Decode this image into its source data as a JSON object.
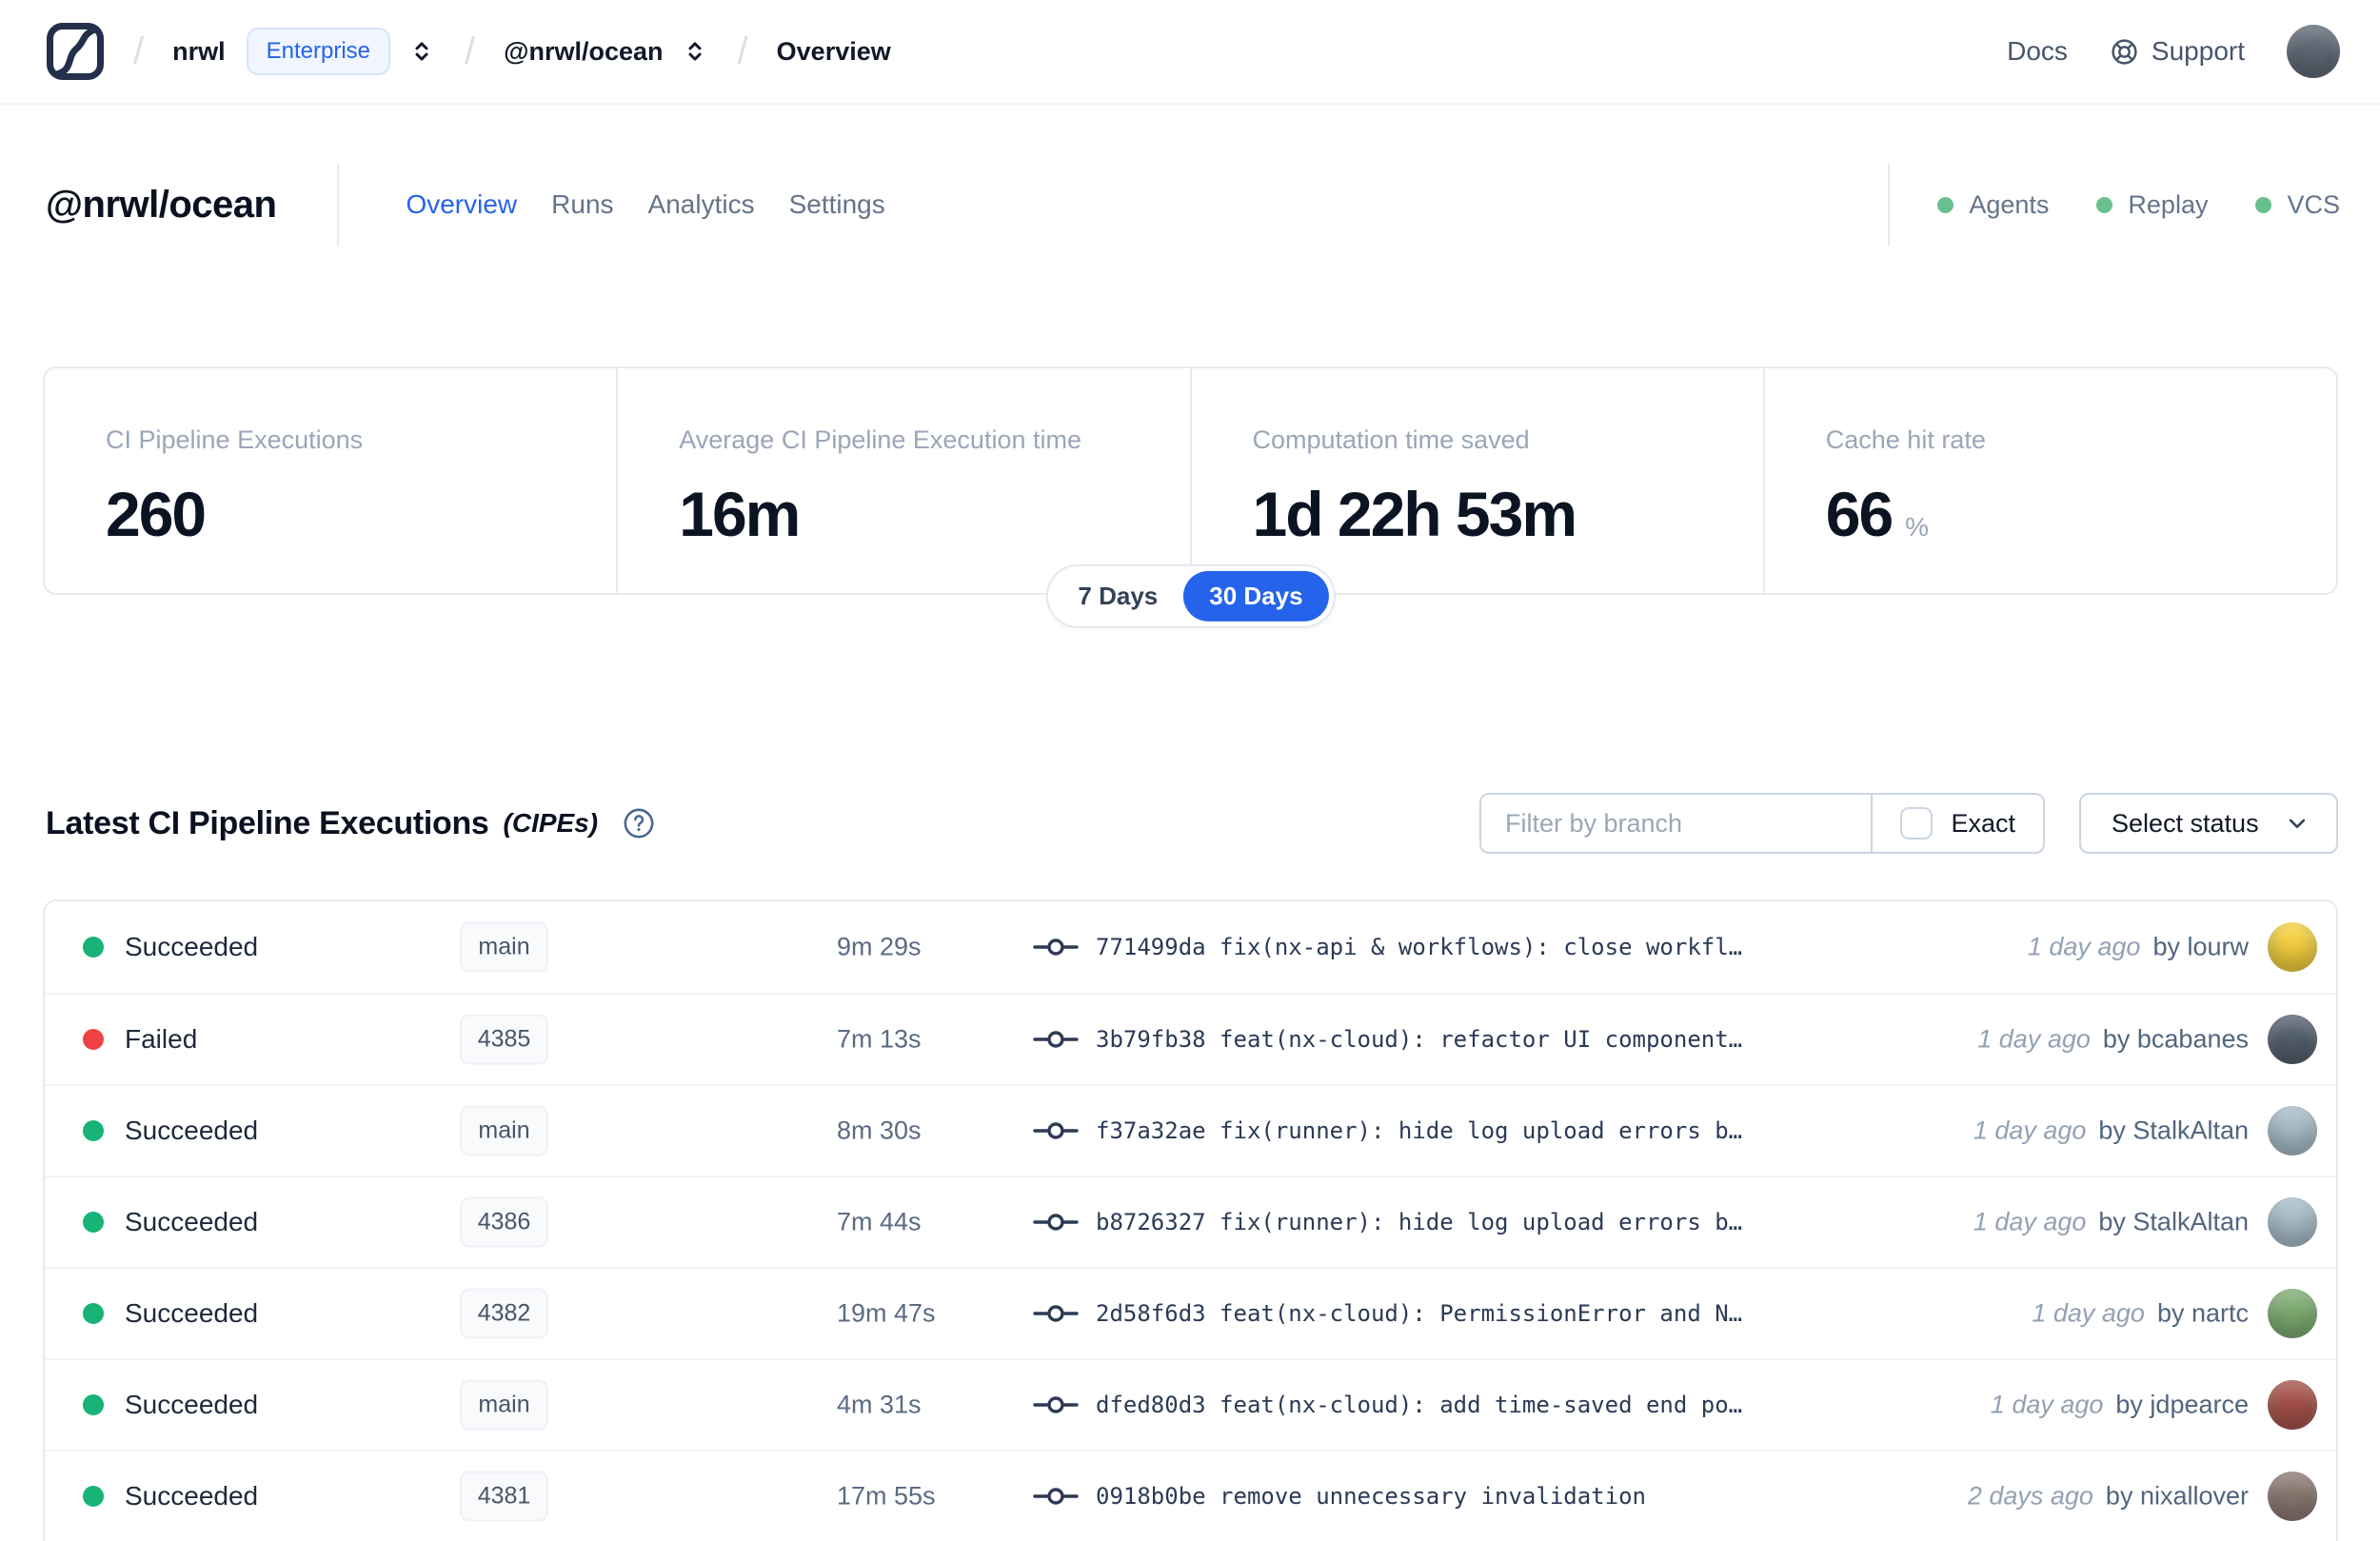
{
  "nav": {
    "breadcrumb": {
      "org": "nrwl",
      "org_badge": "Enterprise",
      "workspace": "@nrwl/ocean",
      "page": "Overview"
    },
    "docs_label": "Docs",
    "support_label": "Support",
    "avatar_color": "#5f6a76"
  },
  "header": {
    "title": "@nrwl/ocean",
    "tabs": [
      {
        "label": "Overview"
      },
      {
        "label": "Runs"
      },
      {
        "label": "Analytics"
      },
      {
        "label": "Settings"
      }
    ],
    "active_tab": "Overview",
    "integrations": [
      {
        "label": "Agents"
      },
      {
        "label": "Replay"
      },
      {
        "label": "VCS"
      }
    ],
    "integration_dot_color": "#68c08e"
  },
  "stats": {
    "cards": [
      {
        "label": "CI Pipeline Executions",
        "value": "260",
        "suffix": ""
      },
      {
        "label": "Average CI Pipeline Execution time",
        "value": "16m",
        "suffix": ""
      },
      {
        "label": "Computation time saved",
        "value": "1d 22h 53m",
        "suffix": ""
      },
      {
        "label": "Cache hit rate",
        "value": "66",
        "suffix": "%"
      }
    ],
    "range_toggle": {
      "options": [
        "7 Days",
        "30 Days"
      ],
      "selected": "30 Days",
      "active_color": "#2563eb"
    }
  },
  "cipes": {
    "title": "Latest CI Pipeline Executions",
    "title_suffix": "(CIPEs)",
    "filter_placeholder": "Filter by branch",
    "exact_label": "Exact",
    "status_select_label": "Select status",
    "success_color": "#17b377",
    "failed_color": "#ee4245",
    "rows": [
      {
        "status": "Succeeded",
        "status_color": "#17b377",
        "branch": "main",
        "duration": "9m 29s",
        "commit": "771499da fix(nx-api & workflows): close workfl…",
        "time": "1 day ago",
        "author": "by lourw",
        "avatar_color": "#f6d23e"
      },
      {
        "status": "Failed",
        "status_color": "#ee4245",
        "branch": "4385",
        "duration": "7m 13s",
        "commit": "3b79fb38 feat(nx-cloud): refactor UI component…",
        "time": "1 day ago",
        "author": "by bcabanes",
        "avatar_color": "#55616e"
      },
      {
        "status": "Succeeded",
        "status_color": "#17b377",
        "branch": "main",
        "duration": "8m 30s",
        "commit": "f37a32ae fix(runner): hide log upload errors b…",
        "time": "1 day ago",
        "author": "by StalkAltan",
        "avatar_color": "#a8bfca"
      },
      {
        "status": "Succeeded",
        "status_color": "#17b377",
        "branch": "4386",
        "duration": "7m 44s",
        "commit": "b8726327 fix(runner): hide log upload errors b…",
        "time": "1 day ago",
        "author": "by StalkAltan",
        "avatar_color": "#a8bfca"
      },
      {
        "status": "Succeeded",
        "status_color": "#17b377",
        "branch": "4382",
        "duration": "19m 47s",
        "commit": "2d58f6d3 feat(nx-cloud): PermissionError and N…",
        "time": "1 day ago",
        "author": "by nartc",
        "avatar_color": "#7fae72"
      },
      {
        "status": "Succeeded",
        "status_color": "#17b377",
        "branch": "main",
        "duration": "4m 31s",
        "commit": "dfed80d3 feat(nx-cloud): add time-saved end po…",
        "time": "1 day ago",
        "author": "by jdpearce",
        "avatar_color": "#a8524b"
      },
      {
        "status": "Succeeded",
        "status_color": "#17b377",
        "branch": "4381",
        "duration": "17m 55s",
        "commit": "0918b0be remove unnecessary invalidation",
        "time": "2 days ago",
        "author": "by nixallover",
        "avatar_color": "#8c7a72"
      }
    ]
  }
}
